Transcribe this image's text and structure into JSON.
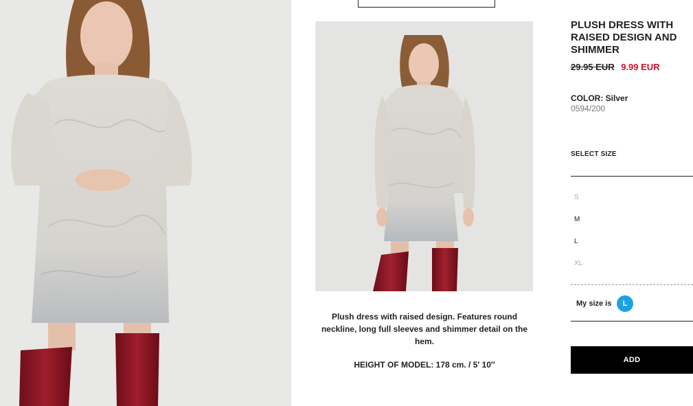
{
  "product": {
    "title": "PLUSH DRESS WITH RAISED DESIGN AND SHIMMER",
    "old_price": "29.95 EUR",
    "new_price": "9.99 EUR",
    "color_label": "COLOR:",
    "color_value": "Silver",
    "reference": "0594/200",
    "description": "Plush dress with raised design. Features round neckline, long full sleeves and shimmer detail on the hem.",
    "model_height": "HEIGHT OF MODEL: 178 cm. / 5′ 10″"
  },
  "size_selector": {
    "label": "SELECT SIZE",
    "sizes": [
      {
        "label": "S",
        "available": false
      },
      {
        "label": "M",
        "available": true
      },
      {
        "label": "L",
        "available": true
      },
      {
        "label": "XL",
        "available": false
      }
    ],
    "my_size_label": "My size is",
    "my_size_value": "L"
  },
  "actions": {
    "add_label": "ADD"
  },
  "colors": {
    "sale_price": "#c8102e",
    "my_size_badge": "#1da1e4",
    "add_button": "#000000"
  },
  "images": {
    "hero": "model-front-closeup-photo",
    "thumbnail": "model-full-length-photo"
  }
}
